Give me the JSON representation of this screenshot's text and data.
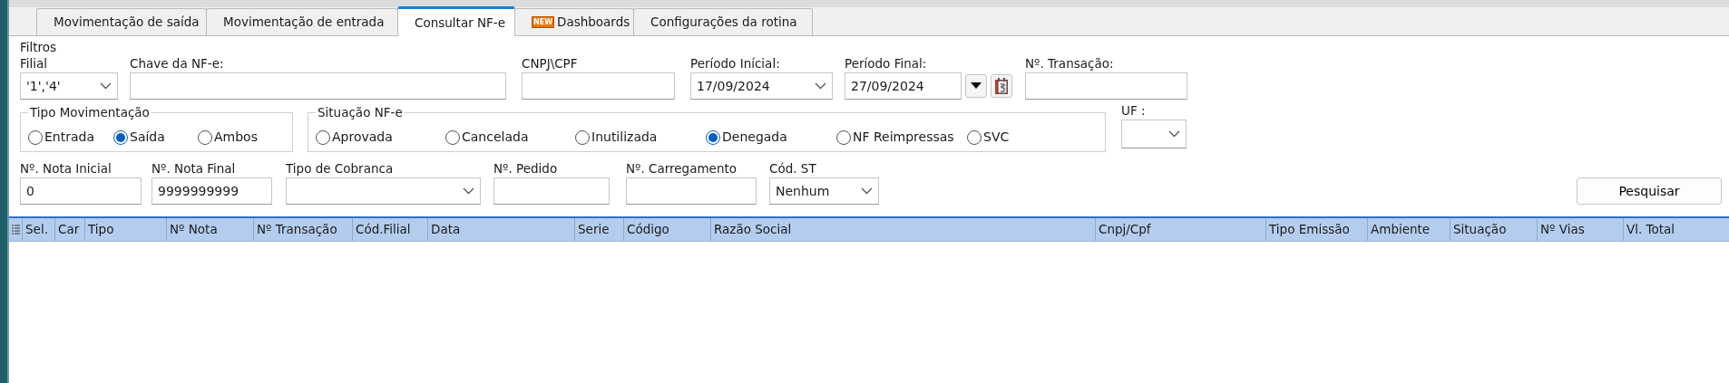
{
  "tabs": [
    {
      "label": "Movimentação de saída",
      "selected": false
    },
    {
      "label": "Movimentação de entrada",
      "selected": false
    },
    {
      "label": "Consultar NF-e",
      "selected": true
    },
    {
      "label": "Dashboards",
      "selected": false,
      "badge": "NEW"
    },
    {
      "label": "Configurações da rotina",
      "selected": false
    }
  ],
  "filters": {
    "title": "Filtros",
    "row1": [
      {
        "kind": "select",
        "label": "Filial",
        "value": "'1','4'"
      },
      {
        "kind": "input",
        "label": "Chave da NF-e:"
      },
      {
        "kind": "input",
        "label": "CNPJ\\CPF"
      },
      {
        "kind": "select",
        "label": "Período Inícial:",
        "value": "17/09/2024"
      },
      {
        "kind": "datepicker",
        "label": "Período Final:",
        "value": "27/09/2024"
      },
      {
        "kind": "input",
        "label": "Nº. Transação:"
      }
    ],
    "groups": [
      {
        "title": "Tipo Movimentação",
        "options": [
          {
            "label": "Entrada",
            "selected": false
          },
          {
            "label": "Saída",
            "selected": true
          },
          {
            "label": "Ambos",
            "selected": false
          }
        ]
      },
      {
        "title": "Situação NF-e",
        "options": [
          {
            "label": "Aprovada",
            "selected": false
          },
          {
            "label": "Cancelada",
            "selected": false
          },
          {
            "label": "Inutilizada",
            "selected": false
          },
          {
            "label": "Denegada",
            "selected": true
          },
          {
            "label": "NF Reimpressas",
            "selected": false
          },
          {
            "label": "SVC",
            "selected": false
          }
        ]
      }
    ],
    "uf": {
      "label": "UF :"
    },
    "row3": [
      {
        "kind": "input",
        "label": "Nº. Nota Inicial",
        "value": "0"
      },
      {
        "kind": "input",
        "label": "Nº. Nota Final",
        "value": "9999999999"
      },
      {
        "kind": "select",
        "label": "Tipo de Cobranca"
      },
      {
        "kind": "input",
        "label": "Nº. Pedido"
      },
      {
        "kind": "input",
        "label": "Nº. Carregamento"
      },
      {
        "kind": "select",
        "label": "Cód. ST",
        "value": "Nenhum"
      }
    ],
    "search_button": "Pesquisar"
  },
  "grid": {
    "columns": [
      "Sel.",
      "Car",
      "Tipo",
      "Nº Nota",
      "Nº Transação",
      "Cód.Filial",
      "Data",
      "Serie",
      "Código",
      "Razão Social",
      "Cnpj/Cpf",
      "Tipo Emissão",
      "Ambiente",
      "Situação",
      "Nº Vias",
      "Vl. Total"
    ]
  }
}
